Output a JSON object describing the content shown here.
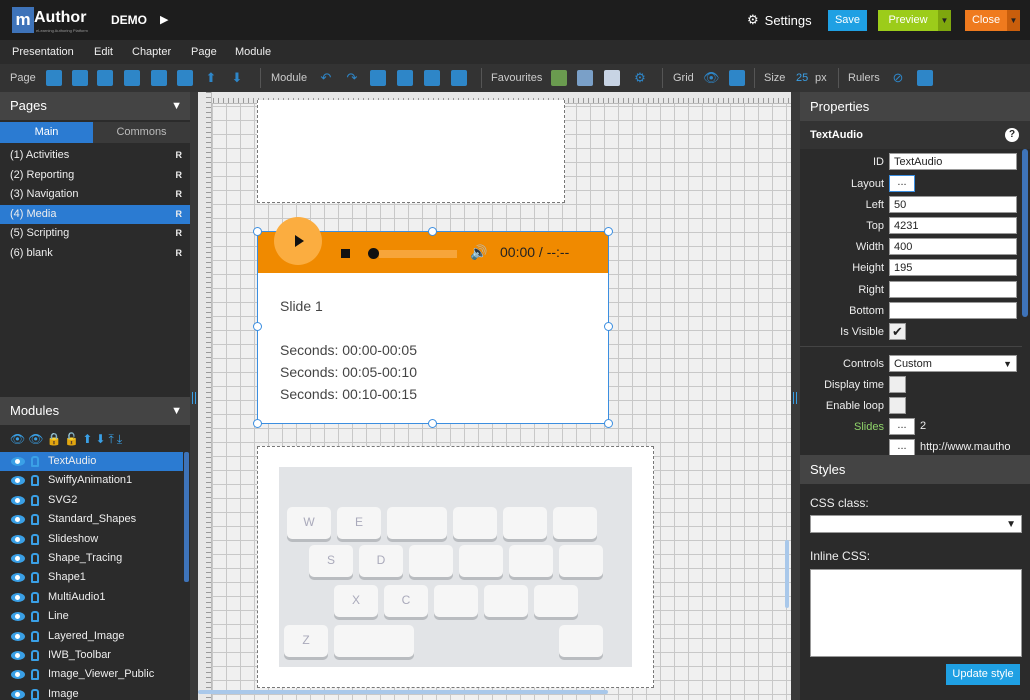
{
  "app": {
    "logo_m": "m",
    "logo_rest": "Author",
    "tagline": "eLearning Authoring Platform",
    "project": "DEMO",
    "settings": "Settings",
    "save": "Save",
    "preview": "Preview",
    "close": "Close"
  },
  "menu": [
    "Presentation",
    "Edit",
    "Chapter",
    "Page",
    "Module"
  ],
  "toolbar": {
    "page": "Page",
    "module": "Module",
    "favourites": "Favourites",
    "grid": "Grid",
    "size": "Size",
    "size_value": "25",
    "size_unit": "px",
    "rulers": "Rulers"
  },
  "pages_panel": {
    "title": "Pages",
    "tab_main": "Main",
    "tab_commons": "Commons",
    "pages": [
      {
        "label": "(1) Activities",
        "flag": "R"
      },
      {
        "label": "(2) Reporting",
        "flag": "R"
      },
      {
        "label": "(3) Navigation",
        "flag": "R"
      },
      {
        "label": "(4) Media",
        "flag": "R"
      },
      {
        "label": "(5) Scripting",
        "flag": "R"
      },
      {
        "label": "(6) blank",
        "flag": "R"
      }
    ]
  },
  "modules_panel": {
    "title": "Modules",
    "modules": [
      "TextAudio",
      "SwiffyAnimation1",
      "SVG2",
      "Standard_Shapes",
      "Slideshow",
      "Shape_Tracing",
      "Shape1",
      "MultiAudio1",
      "Line",
      "Layered_Image",
      "IWB_Toolbar",
      "Image_Viewer_Public",
      "Image"
    ]
  },
  "textaudio": {
    "time": "00:00 / --:--",
    "slide": "Slide 1",
    "lines": [
      "Seconds: 00:00-00:05",
      "Seconds: 00:05-00:10",
      "Seconds: 00:10-00:15"
    ]
  },
  "keyboard_keys": [
    "W",
    "E",
    "S",
    "D",
    "X",
    "C",
    "Z"
  ],
  "properties": {
    "title": "Properties",
    "module_name": "TextAudio",
    "help": "?",
    "fields": {
      "id_label": "ID",
      "id": "TextAudio",
      "layout_label": "Layout",
      "layout_btn": "...",
      "left_label": "Left",
      "left": "50",
      "top_label": "Top",
      "top": "4231",
      "width_label": "Width",
      "width": "400",
      "height_label": "Height",
      "height": "195",
      "right_label": "Right",
      "right": "",
      "bottom_label": "Bottom",
      "bottom": "",
      "visible_label": "Is Visible",
      "controls_label": "Controls",
      "controls": "Custom",
      "display_time_label": "Display time",
      "enable_loop_label": "Enable loop",
      "slides_label": "Slides",
      "slides_btn": "...",
      "slides_count": "2",
      "url_btn": "...",
      "url": "http://www.mautho"
    }
  },
  "styles": {
    "title": "Styles",
    "css_class_label": "CSS class:",
    "inline_css_label": "Inline CSS:",
    "update_btn": "Update style"
  },
  "colors": {
    "accent": "#2b7bd2",
    "save": "#1fa0e3",
    "preview": "#9ccc1a",
    "close": "#ef7a1e",
    "audio_bar": "#f08a00"
  }
}
